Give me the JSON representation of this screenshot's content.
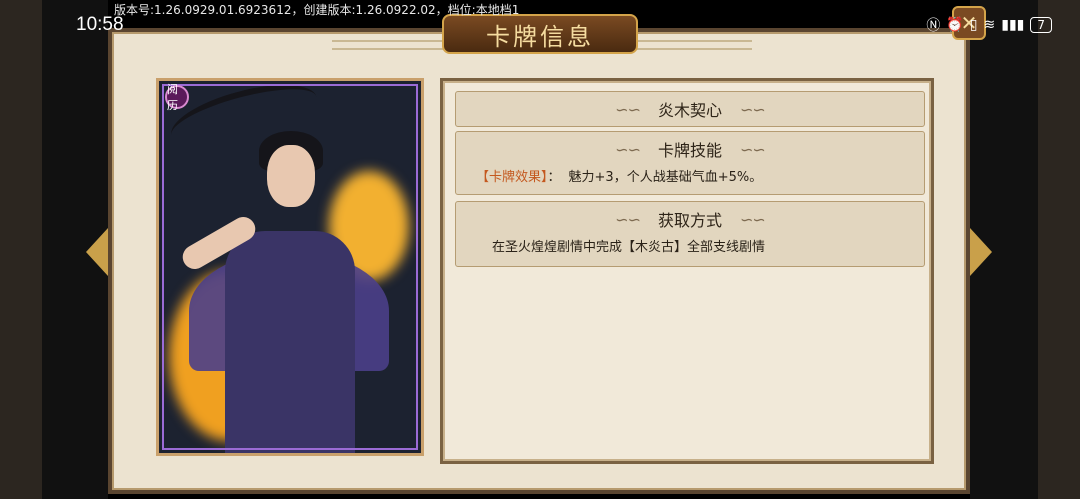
{
  "status_bar": {
    "time": "10:58",
    "version_text": "版本号:1.26.0929.01.6923612，创建版本:1.26.0922.02，档位:本地档1",
    "battery": "7"
  },
  "title": "卡牌信息",
  "card": {
    "badge": "阅历"
  },
  "sections": [
    {
      "title": "炎木契心"
    },
    {
      "title": "卡牌技能",
      "effect_label": "【卡牌效果】",
      "effect_sep": "：",
      "effect_text": "魅力+3，个人战基础气血+5%。"
    },
    {
      "title": "获取方式",
      "text": "在圣火煌煌剧情中完成【木炎古】全部支线剧情"
    }
  ],
  "close_label": "✕",
  "colors": {
    "accent": "#c4581e",
    "panel_bg": "#ece3d0",
    "frame": "#5a4530"
  }
}
